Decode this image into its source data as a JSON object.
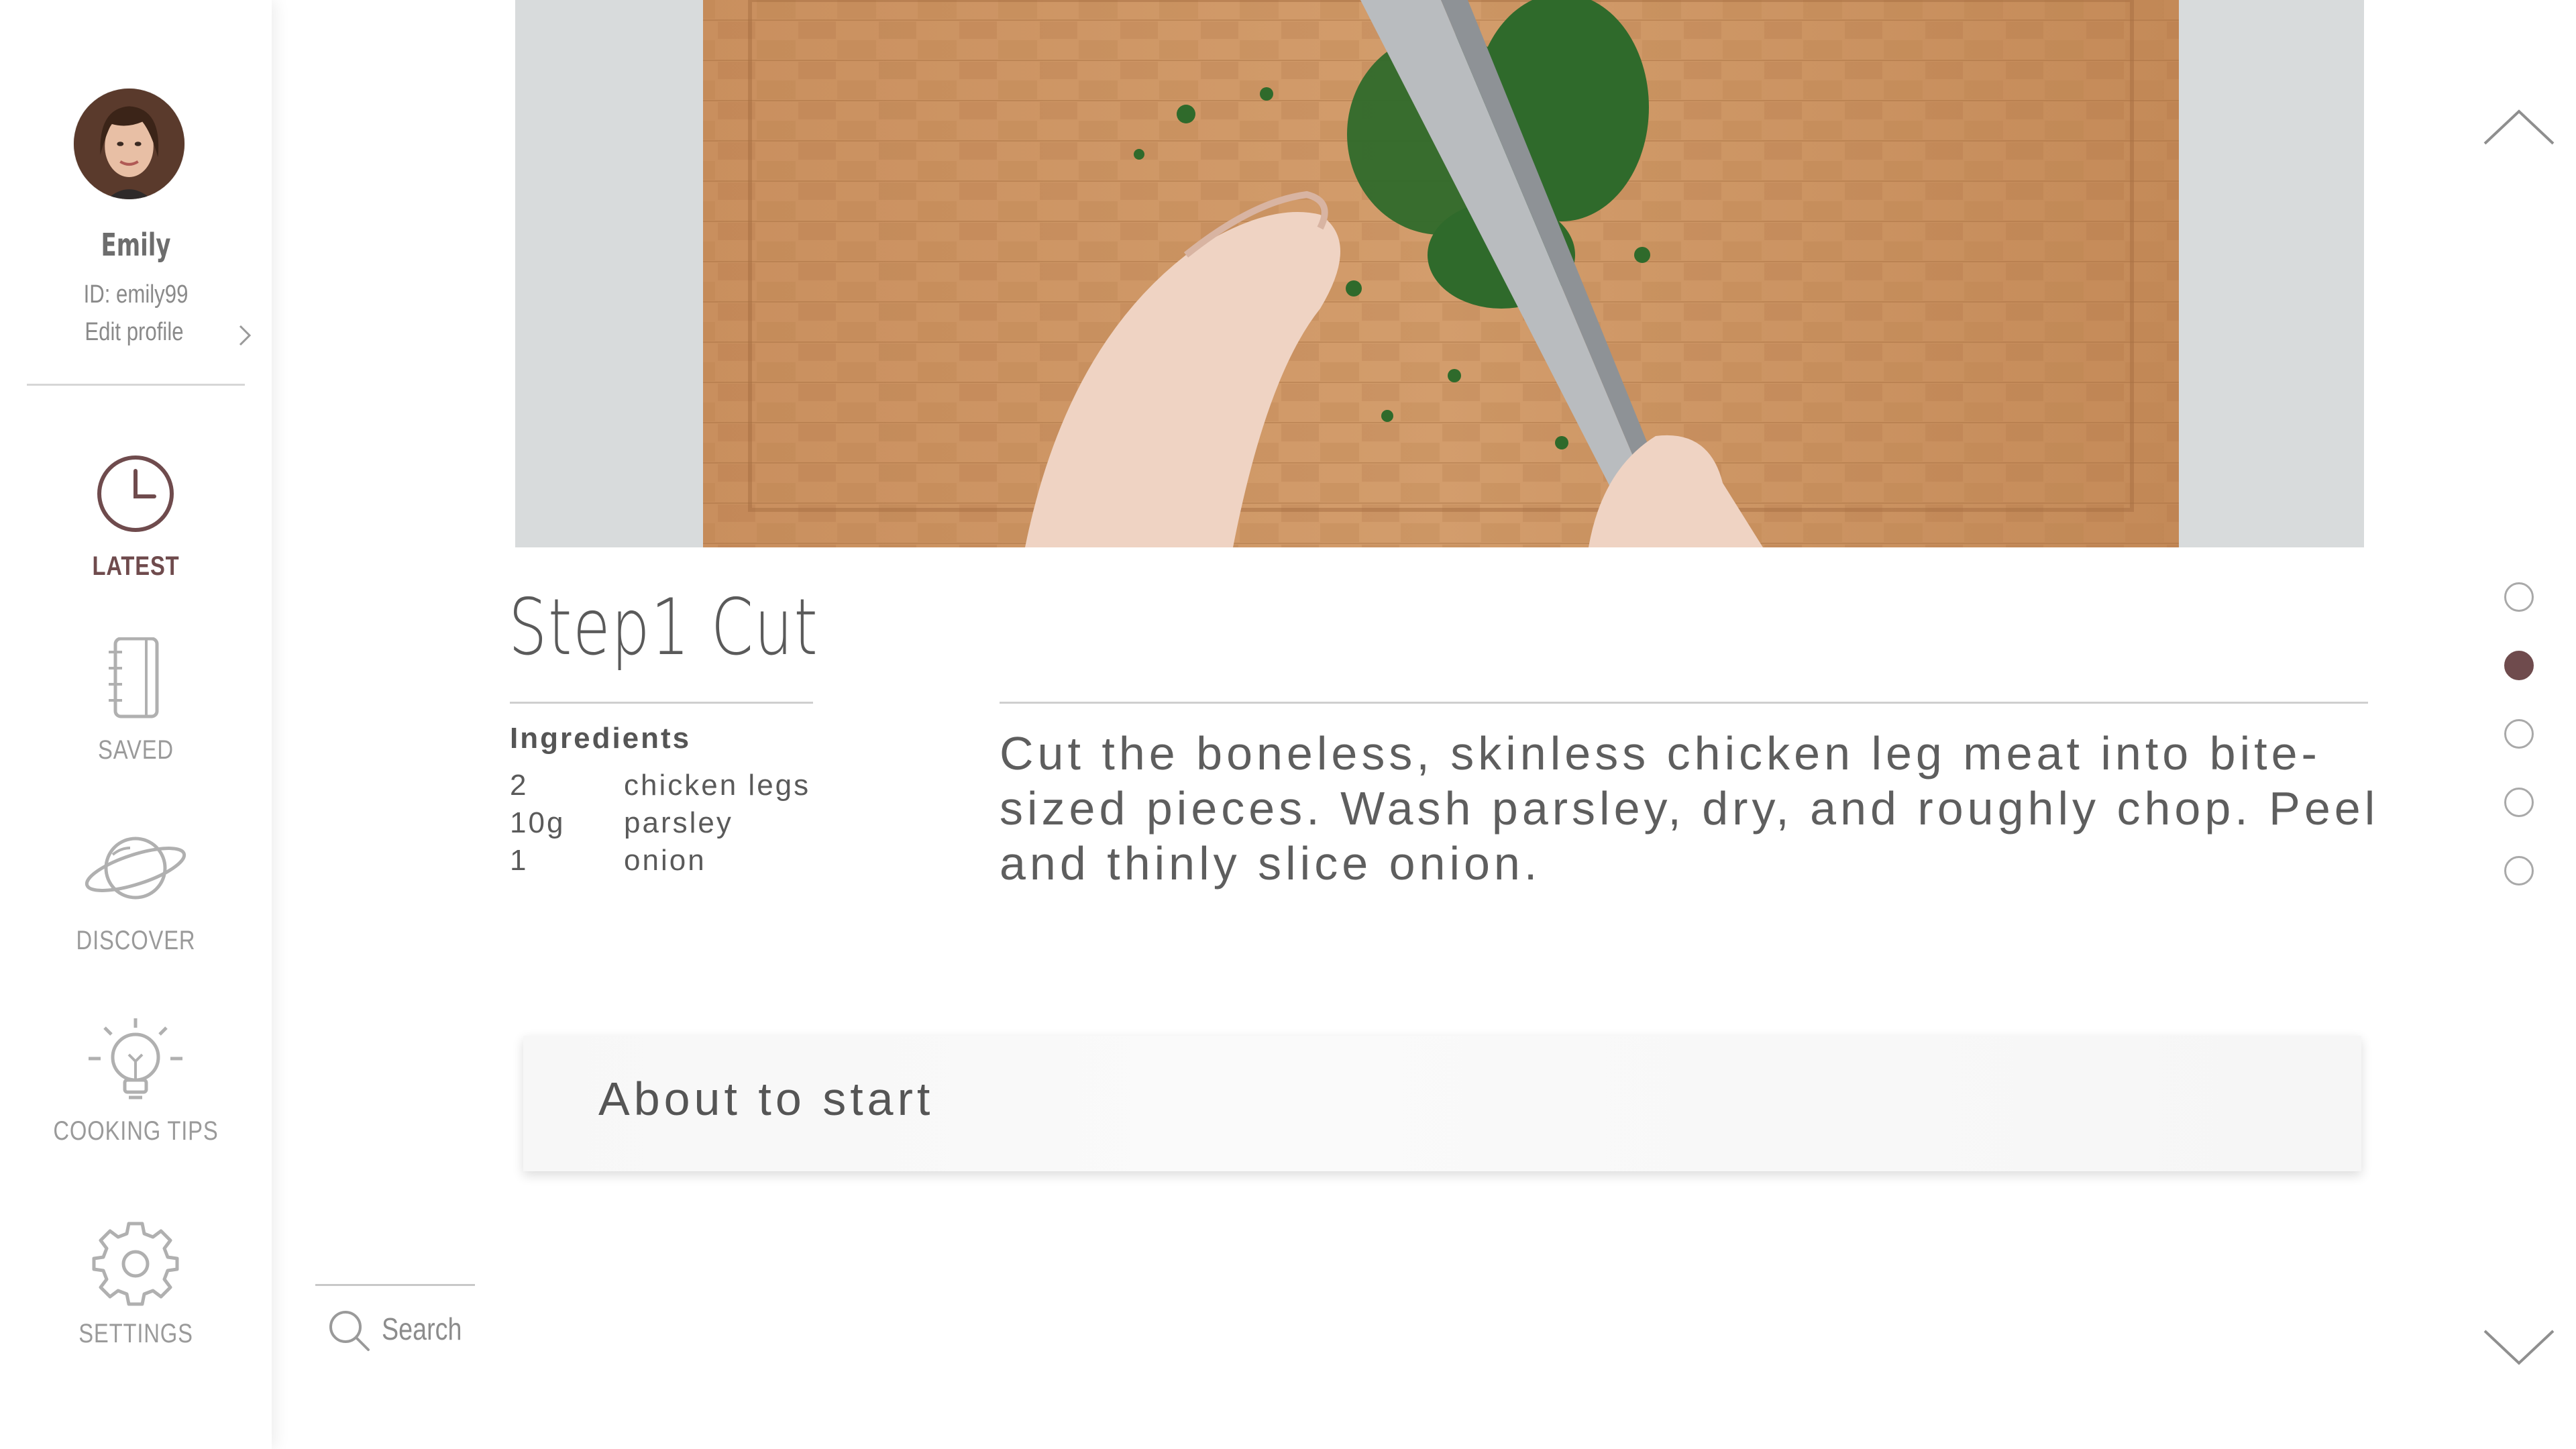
{
  "user": {
    "name": "Emily",
    "id_text": "ID: emily99",
    "edit_profile_label": "Edit profile"
  },
  "nav": {
    "items": [
      {
        "label": "LATEST",
        "icon": "clock-icon",
        "active": true
      },
      {
        "label": "SAVED",
        "icon": "notebook-icon",
        "active": false
      },
      {
        "label": "DISCOVER",
        "icon": "planet-icon",
        "active": false
      },
      {
        "label": "COOKING TIPS",
        "icon": "lightbulb-icon",
        "active": false
      },
      {
        "label": "SETTINGS",
        "icon": "gear-icon",
        "active": false
      }
    ]
  },
  "search": {
    "placeholder": "Search"
  },
  "step": {
    "title": "Step1 Cut",
    "ingredients_heading": "Ingredients",
    "ingredients": [
      {
        "qty": "2",
        "name": "chicken legs"
      },
      {
        "qty": "10g",
        "name": "parsley"
      },
      {
        "qty": "1",
        "name": "onion"
      }
    ],
    "instructions": "Cut the boneless, skinless chicken leg meat into bite-sized pieces. Wash parsley, dry, and roughly chop. Peel and thinly slice onion."
  },
  "status": {
    "text": "About to start"
  },
  "pager": {
    "total": 5,
    "current": 2
  },
  "colors": {
    "accent": "#6f4b4d",
    "text": "#5a5a5a",
    "muted": "#9a9a9a"
  }
}
